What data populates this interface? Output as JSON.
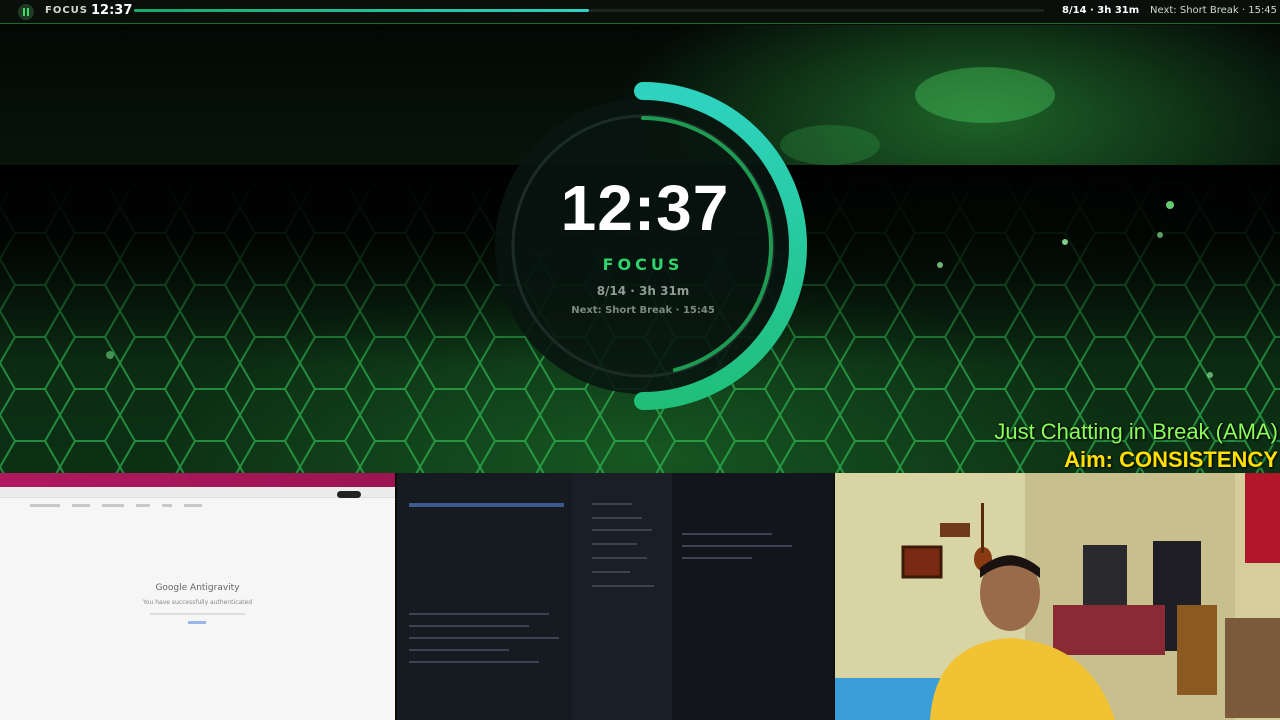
{
  "topbar": {
    "mode_label": "FOCUS",
    "time": "12:37",
    "progress_fraction": 0.5,
    "session": "8/14 · 3h 31m",
    "next": "Next: Short Break · 15:45"
  },
  "timer": {
    "time": "12:37",
    "mode_label": "FOCUS",
    "session": "8/14 · 3h 31m",
    "next": "Next: Short Break · 15:45",
    "ring_fraction": 0.5
  },
  "overlay": {
    "line1": "Just Chatting in Break (AMA)",
    "line2": "Aim: CONSISTENCY"
  },
  "browser_panel": {
    "logo_text": "Google Antigravity",
    "message": "You have successfully authenticated"
  },
  "colors": {
    "accent": "#2fd46a",
    "ring_start": "#1fbf95",
    "ring_end": "#2ed3c0",
    "aim": "#ffe000",
    "chat": "#8cff5a"
  }
}
